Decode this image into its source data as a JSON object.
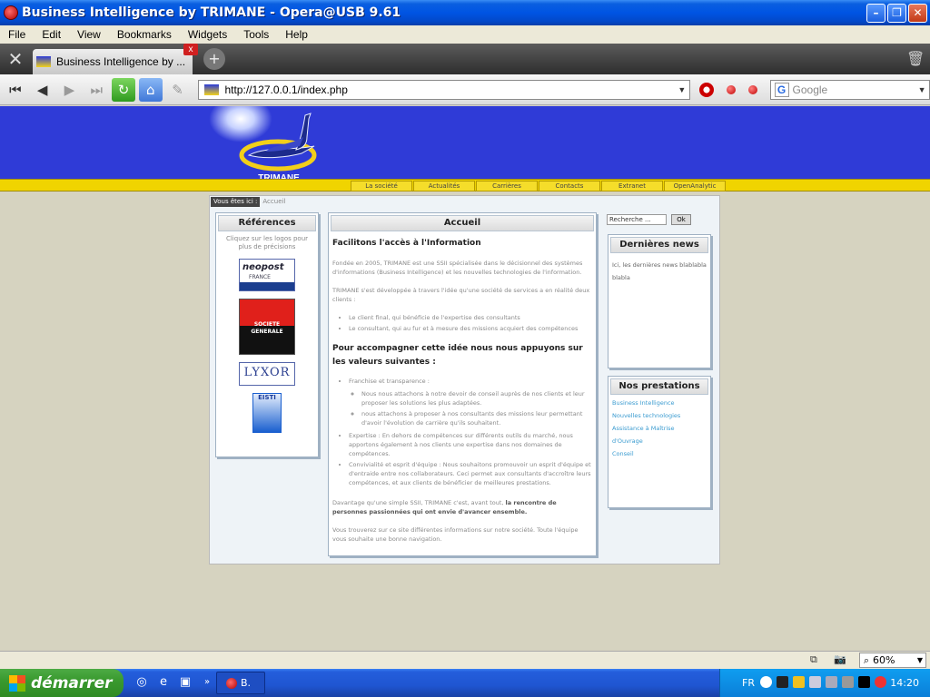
{
  "window": {
    "title": "Business Intelligence by TRIMANE - Opera@USB 9.61"
  },
  "menu": [
    "File",
    "Edit",
    "View",
    "Bookmarks",
    "Widgets",
    "Tools",
    "Help"
  ],
  "tab": {
    "title": "Business Intelligence by ..."
  },
  "address": {
    "url": "http://127.0.0.1/index.php"
  },
  "search": {
    "placeholder": "Google"
  },
  "site": {
    "logo_text": "TRIMANE",
    "nav": [
      "La société",
      "Actualités",
      "Carrières",
      "Contacts",
      "Extranet",
      "OpenAnalytic"
    ],
    "breadcrumb_label": "Vous êtes ici :",
    "breadcrumb_current": "Accueil",
    "references": {
      "title": "Références",
      "hint": "Cliquez sur les logos pour plus de précisions",
      "logos": [
        "neopost",
        "FRANCE",
        "SOCIETE",
        "GENERALE",
        "LYXOR",
        "EISTI"
      ]
    },
    "main": {
      "title": "Accueil",
      "heading1": "Facilitons l'accès à l'Information",
      "p1": "Fondée en 2005, TRIMANE est une SSII spécialisée dans le décisionnel des systèmes d'informations (Business Intelligence) et les nouvelles technologies de l'information.",
      "p2": "TRIMANE s'est développée à travers l'idée qu'une société de services a en réalité deux clients :",
      "list1": [
        "Le client final, qui bénéficie de l'expertise des consultants",
        "Le consultant, qui au fur et à mesure des missions acquiert des compétences"
      ],
      "heading2": "Pour accompagner cette idée nous nous appuyons sur les valeurs suivantes :",
      "value1": "Franchise et transparence :",
      "value1_sub": [
        "Nous nous attachons à notre devoir de conseil auprès de nos clients et leur proposer les solutions les plus adaptées.",
        "nous attachons à proposer à nos consultants des missions leur permettant d'avoir l'évolution de carrière qu'ils souhaitent."
      ],
      "value2": "Expertise : En dehors de compétences sur différents outils du marché, nous apportons également à nos clients une expertise dans nos domaines de compétences.",
      "value3": "Convivialité et esprit d'équipe : Nous souhaitons promouvoir un esprit d'équipe et d'entraide entre nos collaborateurs. Ceci permet aux consultants d'accroître leurs compétences, et aux clients de bénéficier de meilleures prestations.",
      "p3_start": "Davantage qu'une simple SSII, TRIMANE c'est, avant tout,",
      "p3_strong": "la rencontre de personnes passionnées qui ont envie d'avancer ensemble.",
      "p4": "Vous trouverez sur ce site différentes informations sur notre société. Toute l'équipe vous souhaite une bonne navigation."
    },
    "search_form": {
      "value": "Recherche ...",
      "button": "Ok"
    },
    "news": {
      "title": "Dernières news",
      "text": "Ici, les dernières news blablabla blabla"
    },
    "prestations": {
      "title": "Nos prestations",
      "links": [
        "Business Intelligence",
        "Nouvelles technologies",
        "Assistance à Maîtrise d'Ouvrage",
        "Conseil"
      ]
    }
  },
  "status": {
    "zoom": "60%"
  },
  "taskbar": {
    "start": "démarrer",
    "task_label": "B.",
    "lang": "FR",
    "clock": "14:20"
  },
  "colors": {
    "site_header": "#2f3bd7",
    "site_yellow": "#f0d400",
    "xp_blue": "#0054e3",
    "start_green": "#3a9a2f"
  }
}
